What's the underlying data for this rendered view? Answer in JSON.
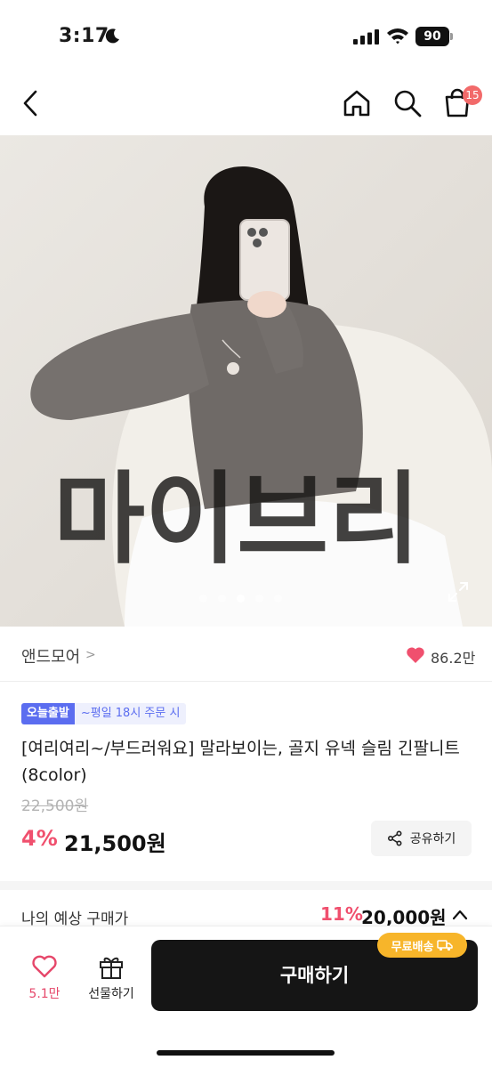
{
  "status_bar": {
    "time": "3:17",
    "battery": "90",
    "icons": [
      "moon-icon",
      "signal-icon",
      "wifi-icon",
      "battery-icon"
    ]
  },
  "nav": {
    "icons": [
      "back-icon",
      "home-icon",
      "search-icon",
      "cart-icon"
    ],
    "cart_badge": "15"
  },
  "hero": {
    "watermark": "마이브리",
    "carousel": {
      "total": 5,
      "active_index": 2
    },
    "icons": [
      "expand-icon"
    ]
  },
  "brand": {
    "name": "앤드모어",
    "chevron": ">",
    "like_count": "86.2만",
    "like_color": "#f0506e"
  },
  "product": {
    "shipping_tag": "오늘출발",
    "shipping_time": "~평일 18시 주문 시",
    "title": "[여리여리~/부드러워요] 말라보이는, 골지 유넥 슬림 긴팔니트 (8color)",
    "original_price": "22,500원",
    "discount": "4%",
    "sale_price": "21,500원",
    "share_label": "공유하기"
  },
  "expected": {
    "label": "나의 예상 구매가",
    "discount": "11%",
    "price": "20,000원"
  },
  "bottom_bar": {
    "wish_count": "5.1만",
    "gift_label": "선물하기",
    "buy_label": "구매하기",
    "free_shipping": "무료배송"
  },
  "colors": {
    "accent_red": "#f0506e",
    "badge_blue": "#5b6df0",
    "free_ship_yellow": "#f7b52a",
    "buy_button": "#151515"
  }
}
